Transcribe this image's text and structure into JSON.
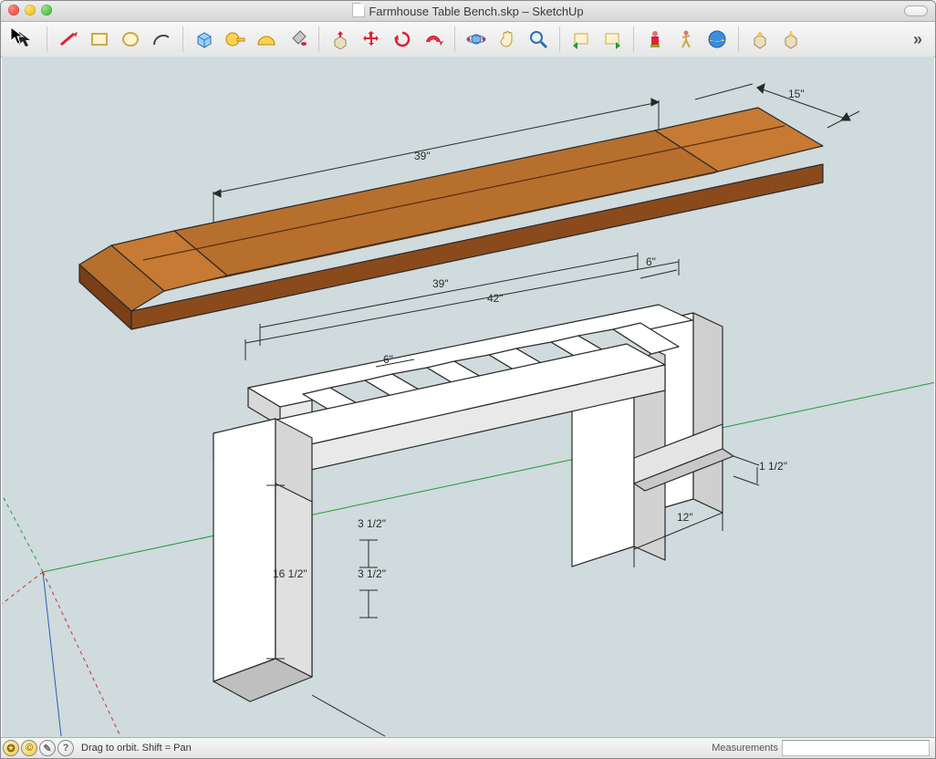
{
  "window": {
    "title": "Farmhouse Table Bench.skp – SketchUp"
  },
  "toolbar": {
    "groups": [
      [
        "select",
        "pencil",
        "rectangle",
        "circle",
        "arc"
      ],
      [
        "pushpull",
        "move",
        "rotate",
        "offset"
      ],
      [
        "bucket",
        "tape",
        "protractor",
        "dimension"
      ],
      [
        "orbit",
        "pan",
        "zoom"
      ],
      [
        "prev",
        "next"
      ],
      [
        "person",
        "walk",
        "earth"
      ],
      [
        "outliner",
        "warehouse"
      ]
    ]
  },
  "status": {
    "hint": "Drag to orbit.  Shift = Pan",
    "measure_label": "Measurements",
    "measure_value": ""
  },
  "dimensions": {
    "top_len": "39\"",
    "top_width": "15\"",
    "frame_inner": "39\"",
    "frame_outer": "42\"",
    "slat_spacing": "6\"",
    "end_spacing": "6\"",
    "leg_height": "16 1/2\"",
    "rail_h1": "3 1/2\"",
    "rail_h2": "3 1/2\"",
    "stretcher_len": "12\"",
    "stretcher_th": "1 1/2\""
  },
  "colors": {
    "wood_light": "#c77a33",
    "wood_dark": "#7a3f16",
    "frame_face": "#ffffff",
    "frame_shade": "#d8d8d8",
    "edge": "#2a2a2a",
    "axis_red": "#c23434",
    "axis_green": "#1f9a3a",
    "axis_blue": "#2a5fb4",
    "bg": "#cfdbdc"
  }
}
